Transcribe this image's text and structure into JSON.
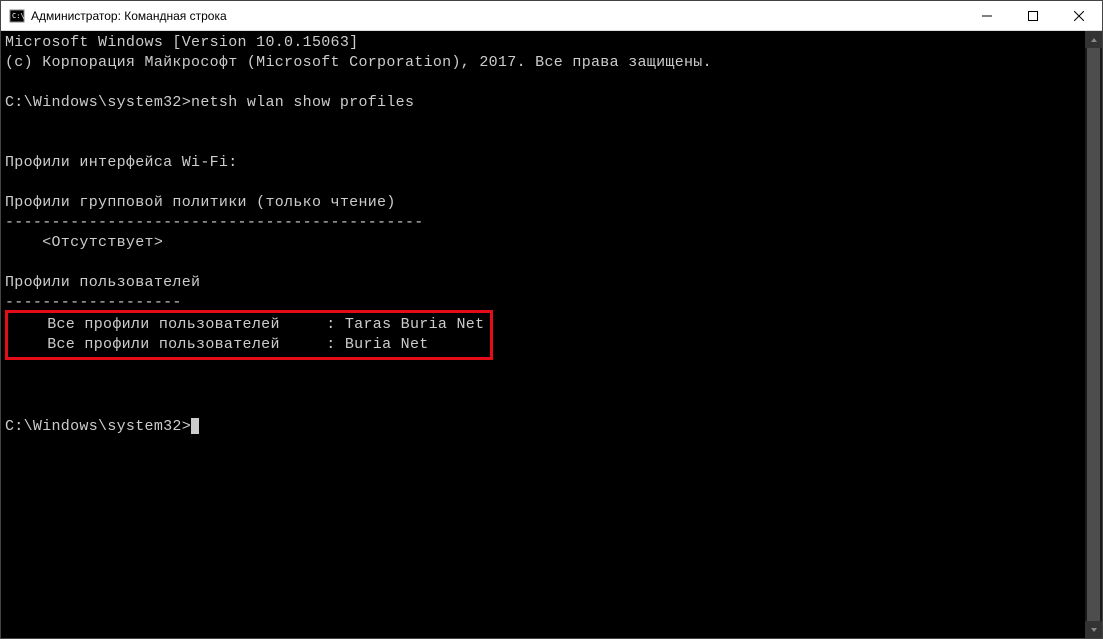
{
  "window": {
    "title": "Администратор: Командная строка"
  },
  "terminal": {
    "line_version": "Microsoft Windows [Version 10.0.15063]",
    "line_copyright": "(c) Корпорация Майкрософт (Microsoft Corporation), 2017. Все права защищены.",
    "prompt1": "C:\\Windows\\system32>",
    "command1": "netsh wlan show profiles",
    "header_interface": "Профили интерфейса Wi-Fi:",
    "header_group_policy": "Профили групповой политики (только чтение)",
    "separator1": "---------------------------------------------",
    "absent": "    <Отсутствует>",
    "header_user_profiles": "Профили пользователей",
    "separator2": "-------------------",
    "profile1_label": "    Все профили пользователей     : ",
    "profile1_value": "Taras Buria Net",
    "profile2_label": "    Все профили пользователей     : ",
    "profile2_value": "Buria Net",
    "prompt2": "C:\\Windows\\system32>"
  }
}
